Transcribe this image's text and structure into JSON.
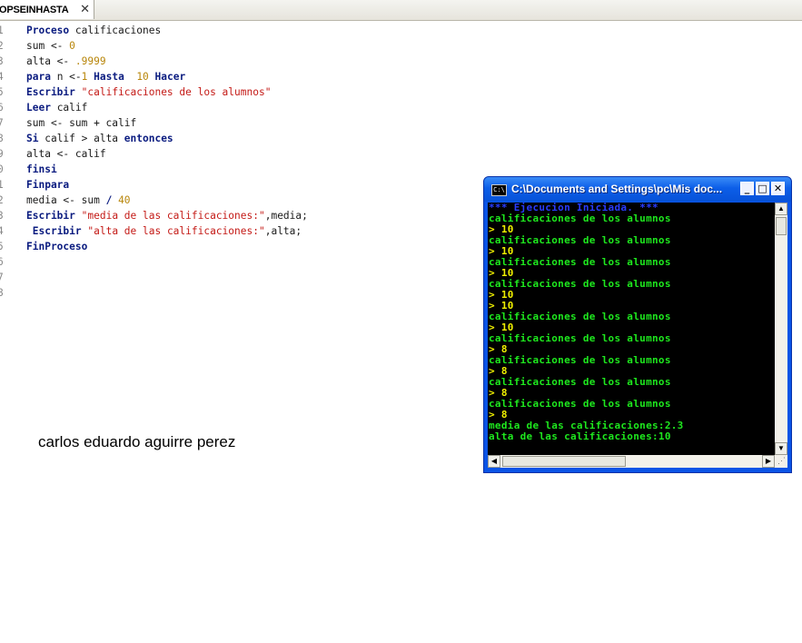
{
  "tab": {
    "label": "OPSEINHASTA",
    "close": "✕"
  },
  "editor": {
    "lines": [
      {
        "n": "1",
        "parts": [
          {
            "t": "Proceso",
            "c": "kw"
          },
          {
            "t": " calificaciones",
            "c": "id"
          }
        ]
      },
      {
        "n": "2",
        "parts": [
          {
            "t": "sum <- ",
            "c": "id"
          },
          {
            "t": "0",
            "c": "num"
          }
        ]
      },
      {
        "n": "3",
        "parts": [
          {
            "t": "alta <- ",
            "c": "id"
          },
          {
            "t": ".9999",
            "c": "num"
          }
        ]
      },
      {
        "n": "4",
        "parts": [
          {
            "t": "para",
            "c": "kw"
          },
          {
            "t": " n <-",
            "c": "id"
          },
          {
            "t": "1",
            "c": "num"
          },
          {
            "t": " ",
            "c": "id"
          },
          {
            "t": "Hasta",
            "c": "kw"
          },
          {
            "t": "  ",
            "c": "id"
          },
          {
            "t": "10",
            "c": "num"
          },
          {
            "t": " ",
            "c": "id"
          },
          {
            "t": "Hacer",
            "c": "kw"
          }
        ]
      },
      {
        "n": "5",
        "parts": [
          {
            "t": "Escribir",
            "c": "kw"
          },
          {
            "t": " ",
            "c": "id"
          },
          {
            "t": "\"calificaciones de los alumnos\"",
            "c": "str"
          }
        ]
      },
      {
        "n": "6",
        "parts": [
          {
            "t": "Leer",
            "c": "kw"
          },
          {
            "t": " calif",
            "c": "id"
          }
        ]
      },
      {
        "n": "7",
        "parts": [
          {
            "t": "sum <- sum + calif",
            "c": "id"
          }
        ]
      },
      {
        "n": "8",
        "parts": [
          {
            "t": "Si",
            "c": "kw"
          },
          {
            "t": " calif > alta ",
            "c": "id"
          },
          {
            "t": "entonces",
            "c": "kw"
          }
        ]
      },
      {
        "n": "9",
        "parts": [
          {
            "t": "alta <- calif",
            "c": "id"
          }
        ]
      },
      {
        "n": "0",
        "parts": [
          {
            "t": "finsi",
            "c": "kw"
          }
        ]
      },
      {
        "n": "1",
        "parts": [
          {
            "t": "Finpara",
            "c": "kw"
          }
        ]
      },
      {
        "n": "2",
        "parts": [
          {
            "t": "media <- sum ",
            "c": "id"
          },
          {
            "t": "/",
            "c": "kw"
          },
          {
            "t": " ",
            "c": "id"
          },
          {
            "t": "40",
            "c": "num"
          }
        ]
      },
      {
        "n": "3",
        "parts": [
          {
            "t": "Escribir",
            "c": "kw"
          },
          {
            "t": " ",
            "c": "id"
          },
          {
            "t": "\"media de las calificaciones:\"",
            "c": "str"
          },
          {
            "t": ",media;",
            "c": "id"
          }
        ]
      },
      {
        "n": "4",
        "parts": [
          {
            "t": " ",
            "c": "id"
          },
          {
            "t": "Escribir",
            "c": "kw"
          },
          {
            "t": " ",
            "c": "id"
          },
          {
            "t": "\"alta de las calificaciones:\"",
            "c": "str"
          },
          {
            "t": ",alta;",
            "c": "id"
          }
        ]
      },
      {
        "n": "5",
        "parts": [
          {
            "t": "FinProceso",
            "c": "kw"
          }
        ]
      },
      {
        "n": "6",
        "parts": []
      },
      {
        "n": "7",
        "parts": []
      },
      {
        "n": "8",
        "parts": []
      }
    ]
  },
  "author": "carlos eduardo aguirre perez",
  "console": {
    "title": "C:\\Documents and Settings\\pc\\Mis doc...",
    "icon": "C:\\",
    "buttons": {
      "minimize": "_",
      "maximize": "□",
      "close": "✕"
    },
    "lines": [
      {
        "t": "*** Ejecucion Iniciada. ***",
        "c": "blue"
      },
      {
        "t": "calificaciones de los alumnos",
        "c": "green"
      },
      {
        "t": "> 10",
        "c": "yellow"
      },
      {
        "t": "calificaciones de los alumnos",
        "c": "green"
      },
      {
        "t": "> 10",
        "c": "yellow"
      },
      {
        "t": "calificaciones de los alumnos",
        "c": "green"
      },
      {
        "t": "> 10",
        "c": "yellow"
      },
      {
        "t": "calificaciones de los alumnos",
        "c": "green"
      },
      {
        "t": "> 10",
        "c": "yellow"
      },
      {
        "t": "> 10",
        "c": "yellow"
      },
      {
        "t": "calificaciones de los alumnos",
        "c": "green"
      },
      {
        "t": "> 10",
        "c": "yellow"
      },
      {
        "t": "calificaciones de los alumnos",
        "c": "green"
      },
      {
        "t": "> 8",
        "c": "yellow"
      },
      {
        "t": "calificaciones de los alumnos",
        "c": "green"
      },
      {
        "t": "> 8",
        "c": "yellow"
      },
      {
        "t": "calificaciones de los alumnos",
        "c": "green"
      },
      {
        "t": "> 8",
        "c": "yellow"
      },
      {
        "t": "calificaciones de los alumnos",
        "c": "green"
      },
      {
        "t": "> 8",
        "c": "yellow"
      },
      {
        "t": "media de las calificaciones:2.3",
        "c": "green"
      },
      {
        "t": "alta de las calificaciones:10",
        "c": "green"
      }
    ]
  }
}
